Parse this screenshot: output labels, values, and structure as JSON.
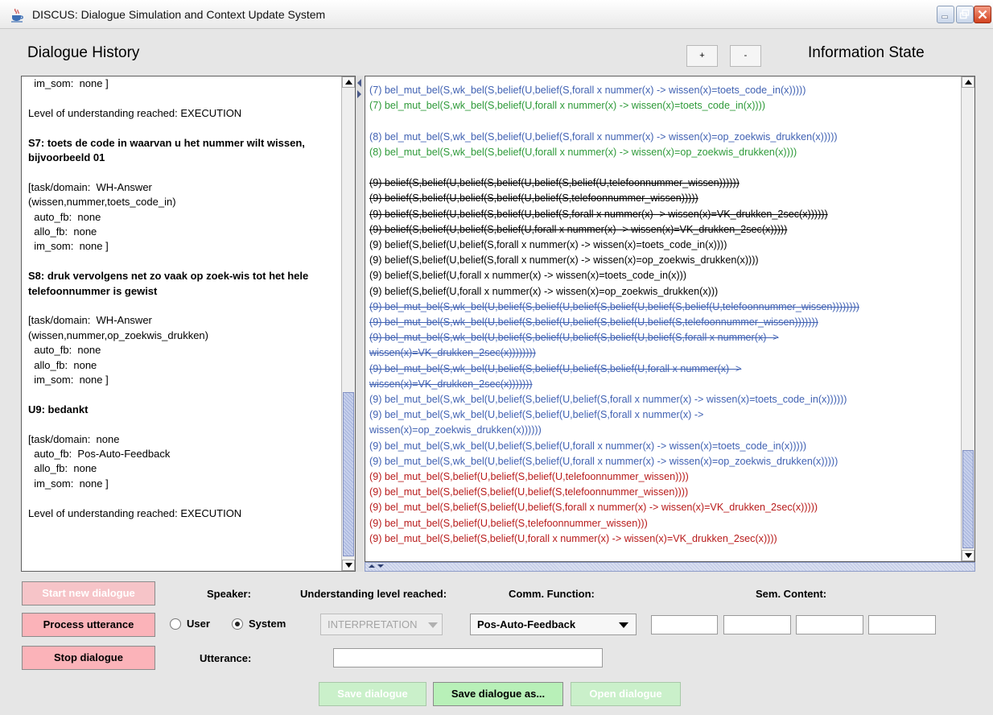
{
  "window": {
    "title": "DISCUS: Dialogue Simulation and Context Update System",
    "icon": "java-cup-icon"
  },
  "header": {
    "dialogue_history": "Dialogue History",
    "information_state": "Information State",
    "zoom_in_label": "+",
    "zoom_out_label": "-"
  },
  "history": [
    {
      "t": "  im_som:  none ]",
      "b": false
    },
    {
      "t": "",
      "b": false
    },
    {
      "t": "Level of understanding reached: EXECUTION",
      "b": false
    },
    {
      "t": "",
      "b": false
    },
    {
      "t": "S7: toets de code in waarvan u het nummer wilt wissen, bijvoorbeeld 01",
      "b": true
    },
    {
      "t": "",
      "b": false
    },
    {
      "t": "[task/domain:  WH-Answer",
      "b": false
    },
    {
      "t": "(wissen,nummer,toets_code_in)",
      "b": false
    },
    {
      "t": "  auto_fb:  none",
      "b": false
    },
    {
      "t": "  allo_fb:  none",
      "b": false
    },
    {
      "t": "  im_som:  none ]",
      "b": false
    },
    {
      "t": "",
      "b": false
    },
    {
      "t": "S8: druk vervolgens net zo vaak op zoek-wis tot het hele telefoonnummer is gewist",
      "b": true
    },
    {
      "t": "",
      "b": false
    },
    {
      "t": "[task/domain:  WH-Answer",
      "b": false
    },
    {
      "t": "(wissen,nummer,op_zoekwis_drukken)",
      "b": false
    },
    {
      "t": "  auto_fb:  none",
      "b": false
    },
    {
      "t": "  allo_fb:  none",
      "b": false
    },
    {
      "t": "  im_som:  none ]",
      "b": false
    },
    {
      "t": "",
      "b": false
    },
    {
      "t": "U9: bedankt",
      "b": true
    },
    {
      "t": "",
      "b": false
    },
    {
      "t": "[task/domain:  none",
      "b": false
    },
    {
      "t": "  auto_fb:  Pos-Auto-Feedback",
      "b": false
    },
    {
      "t": "  allo_fb:  none",
      "b": false
    },
    {
      "t": "  im_som:  none ]",
      "b": false
    },
    {
      "t": "",
      "b": false
    },
    {
      "t": "Level of understanding reached: EXECUTION",
      "b": false
    }
  ],
  "info_state": [
    {
      "t": "(7)   bel_mut_bel(S,wk_bel(S,belief(U,belief(S,forall x nummer(x) -> wissen(x)=toets_code_in(x)))))",
      "c": "blue",
      "s": false
    },
    {
      "t": "(7)   bel_mut_bel(S,wk_bel(S,belief(U,forall x nummer(x) -> wissen(x)=toets_code_in(x))))",
      "c": "green",
      "s": false
    },
    {
      "t": "",
      "c": "black",
      "s": false
    },
    {
      "t": "(8)   bel_mut_bel(S,wk_bel(S,belief(U,belief(S,forall x nummer(x) -> wissen(x)=op_zoekwis_drukken(x)))))",
      "c": "blue",
      "s": false
    },
    {
      "t": "(8)   bel_mut_bel(S,wk_bel(S,belief(U,forall x nummer(x) -> wissen(x)=op_zoekwis_drukken(x))))",
      "c": "green",
      "s": false
    },
    {
      "t": "",
      "c": "black",
      "s": false
    },
    {
      "t": "(9)   belief(S,belief(U,belief(S,belief(U,belief(S,belief(U,telefoonnummer_wissen))))))",
      "c": "black",
      "s": true
    },
    {
      "t": "(9)   belief(S,belief(U,belief(S,belief(U,belief(S,telefoonnummer_wissen)))))",
      "c": "black",
      "s": true
    },
    {
      "t": "(9)   belief(S,belief(U,belief(S,belief(U,belief(S,forall x nummer(x) -> wissen(x)=VK_drukken_2sec(x))))))",
      "c": "black",
      "s": true
    },
    {
      "t": "(9)   belief(S,belief(U,belief(S,belief(U,forall x nummer(x) -> wissen(x)=VK_drukken_2sec(x)))))",
      "c": "black",
      "s": true
    },
    {
      "t": "(9)   belief(S,belief(U,belief(S,forall x nummer(x) -> wissen(x)=toets_code_in(x))))",
      "c": "black",
      "s": false
    },
    {
      "t": "(9)   belief(S,belief(U,belief(S,forall x nummer(x) -> wissen(x)=op_zoekwis_drukken(x))))",
      "c": "black",
      "s": false
    },
    {
      "t": "(9)   belief(S,belief(U,forall x nummer(x) -> wissen(x)=toets_code_in(x)))",
      "c": "black",
      "s": false
    },
    {
      "t": "(9)   belief(S,belief(U,forall x nummer(x) -> wissen(x)=op_zoekwis_drukken(x)))",
      "c": "black",
      "s": false
    },
    {
      "t": "(9)   bel_mut_bel(S,wk_bel(U,belief(S,belief(U,belief(S,belief(U,belief(S,belief(U,telefoonnummer_wissen))))))))",
      "c": "blue",
      "s": true
    },
    {
      "t": "(9)   bel_mut_bel(S,wk_bel(U,belief(S,belief(U,belief(S,belief(U,belief(S,telefoonnummer_wissen)))))))",
      "c": "blue",
      "s": true
    },
    {
      "t": "(9)   bel_mut_bel(S,wk_bel(U,belief(S,belief(U,belief(S,belief(U,belief(S,forall x nummer(x) ->",
      "c": "blue",
      "s": true
    },
    {
      "t": "wissen(x)=VK_drukken_2sec(x))))))))",
      "c": "blue",
      "s": true
    },
    {
      "t": "(9)   bel_mut_bel(S,wk_bel(U,belief(S,belief(U,belief(S,belief(U,forall x nummer(x) ->",
      "c": "blue",
      "s": true
    },
    {
      "t": "wissen(x)=VK_drukken_2sec(x)))))))",
      "c": "blue",
      "s": true
    },
    {
      "t": "(9)   bel_mut_bel(S,wk_bel(U,belief(S,belief(U,belief(S,forall x nummer(x) -> wissen(x)=toets_code_in(x))))))",
      "c": "blue",
      "s": false
    },
    {
      "t": "(9)   bel_mut_bel(S,wk_bel(U,belief(S,belief(U,belief(S,forall x nummer(x) ->",
      "c": "blue",
      "s": false
    },
    {
      "t": "wissen(x)=op_zoekwis_drukken(x))))))",
      "c": "blue",
      "s": false
    },
    {
      "t": "(9)   bel_mut_bel(S,wk_bel(U,belief(S,belief(U,forall x nummer(x) -> wissen(x)=toets_code_in(x)))))",
      "c": "blue",
      "s": false
    },
    {
      "t": "(9)   bel_mut_bel(S,wk_bel(U,belief(S,belief(U,forall x nummer(x) -> wissen(x)=op_zoekwis_drukken(x)))))",
      "c": "blue",
      "s": false
    },
    {
      "t": "(9)   bel_mut_bel(S,belief(U,belief(S,belief(U,telefoonnummer_wissen))))",
      "c": "red",
      "s": false
    },
    {
      "t": "(9)   bel_mut_bel(S,belief(S,belief(U,belief(S,telefoonnummer_wissen))))",
      "c": "red",
      "s": false
    },
    {
      "t": "(9)   bel_mut_bel(S,belief(S,belief(U,belief(S,forall x nummer(x) -> wissen(x)=VK_drukken_2sec(x)))))",
      "c": "red",
      "s": false
    },
    {
      "t": "(9)   bel_mut_bel(S,belief(U,belief(S,telefoonnummer_wissen)))",
      "c": "red",
      "s": false
    },
    {
      "t": "(9)   bel_mut_bel(S,belief(S,belief(U,forall x nummer(x) -> wissen(x)=VK_drukken_2sec(x))))",
      "c": "red",
      "s": false
    }
  ],
  "controls": {
    "start_new_dialogue": "Start new dialogue",
    "process_utterance": "Process utterance",
    "stop_dialogue": "Stop dialogue",
    "speaker_label": "Speaker:",
    "understanding_label": "Understanding level reached:",
    "comm_function_label": "Comm. Function:",
    "sem_content_label": "Sem. Content:",
    "utterance_label": "Utterance:",
    "speaker_user": "User",
    "speaker_system": "System",
    "speaker_selected": "System",
    "understanding_value": "INTERPRETATION",
    "comm_function_value": "Pos-Auto-Feedback",
    "utterance_value": "",
    "sem_content_values": [
      "",
      "",
      "",
      ""
    ],
    "save_dialogue": "Save dialogue",
    "save_dialogue_as": "Save dialogue as...",
    "open_dialogue": "Open dialogue"
  },
  "colors": {
    "blue": "#4162b3",
    "green": "#2e9a39",
    "black": "#000000",
    "red": "#b81b1b",
    "button_red": "#fbb3b9",
    "button_green": "#b8f0b8"
  }
}
